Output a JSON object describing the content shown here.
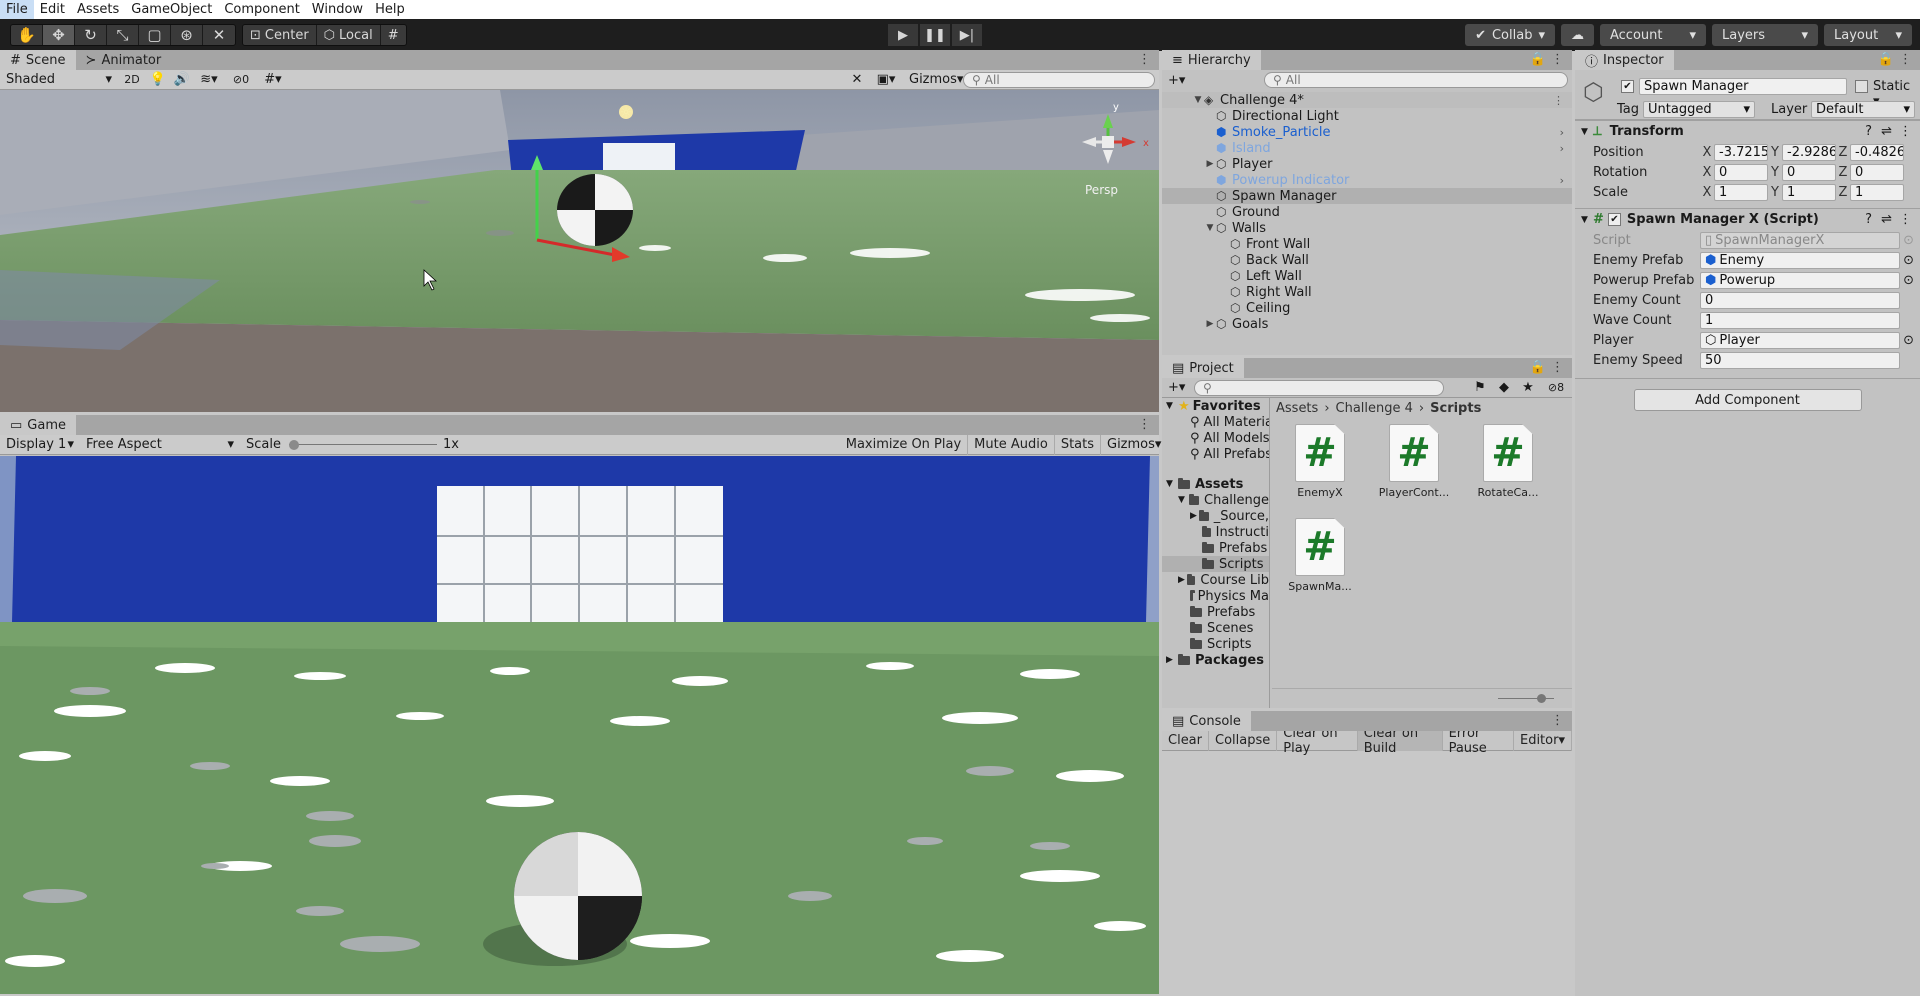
{
  "menu": [
    "File",
    "Edit",
    "Assets",
    "GameObject",
    "Component",
    "Window",
    "Help"
  ],
  "toolbar": {
    "pivot_label": "Center",
    "space_label": "Local",
    "collab_label": "Collab",
    "account_label": "Account",
    "layers_label": "Layers",
    "layout_label": "Layout"
  },
  "scene_panel": {
    "tabs": [
      "Scene",
      "Animator"
    ],
    "shading": "Shaded",
    "mode_2d": "2D",
    "hidden_count": "0",
    "gizmos_label": "Gizmos",
    "search_placeholder": "All",
    "persp_label": "Persp",
    "gizmo_y": "y",
    "gizmo_x": "x"
  },
  "game_panel": {
    "tab": "Game",
    "display": "Display 1",
    "aspect": "Free Aspect",
    "scale_label": "Scale",
    "scale_value": "1x",
    "maximize": "Maximize On Play",
    "mute": "Mute Audio",
    "stats": "Stats",
    "gizmos_label": "Gizmos"
  },
  "hierarchy": {
    "title": "Hierarchy",
    "search_placeholder": "All",
    "scene_name": "Challenge 4*",
    "items": [
      {
        "label": "Directional Light",
        "kind": "normal"
      },
      {
        "label": "Smoke_Particle",
        "kind": "prefab"
      },
      {
        "label": "Island",
        "kind": "prefab-dim"
      },
      {
        "label": "Player",
        "kind": "normal"
      },
      {
        "label": "Powerup Indicator",
        "kind": "prefab-dim"
      },
      {
        "label": "Spawn Manager",
        "kind": "normal"
      },
      {
        "label": "Ground",
        "kind": "normal"
      },
      {
        "label": "Walls",
        "kind": "normal"
      },
      {
        "label": "Front Wall",
        "kind": "child"
      },
      {
        "label": "Back Wall",
        "kind": "child"
      },
      {
        "label": "Left Wall",
        "kind": "child"
      },
      {
        "label": "Right Wall",
        "kind": "child"
      },
      {
        "label": "Ceiling",
        "kind": "child"
      },
      {
        "label": "Goals",
        "kind": "normal"
      }
    ]
  },
  "project": {
    "title": "Project",
    "hidden_count": "8",
    "favorites_label": "Favorites",
    "favorites": [
      "All Materia",
      "All Models",
      "All Prefabs"
    ],
    "assets_label": "Assets",
    "tree": [
      "Challenge",
      "_Source,",
      "Instructi",
      "Prefabs",
      "Scripts",
      "Course Lib",
      "Physics Ma",
      "Prefabs",
      "Scenes",
      "Scripts"
    ],
    "packages_label": "Packages",
    "breadcrumb": [
      "Assets",
      "Challenge 4",
      "Scripts"
    ],
    "files": [
      "EnemyX",
      "PlayerCont...",
      "RotateCa...",
      "SpawnMa..."
    ]
  },
  "console": {
    "title": "Console",
    "buttons": [
      "Clear",
      "Collapse",
      "Clear on Play",
      "Clear on Build",
      "Error Pause",
      "Editor"
    ]
  },
  "inspector": {
    "title": "Inspector",
    "object_name": "Spawn Manager",
    "static_label": "Static",
    "tag_label": "Tag",
    "tag_value": "Untagged",
    "layer_label": "Layer",
    "layer_value": "Default",
    "transform": {
      "title": "Transform",
      "position_label": "Position",
      "rotation_label": "Rotation",
      "scale_label": "Scale",
      "position": [
        "-3.7215",
        "-2.9286",
        "-0.4826"
      ],
      "rotation": [
        "0",
        "0",
        "0"
      ],
      "scale": [
        "1",
        "1",
        "1"
      ]
    },
    "script_component": {
      "title": "Spawn Manager X (Script)",
      "script_label": "Script",
      "script_value": "SpawnManagerX",
      "enemy_prefab_label": "Enemy Prefab",
      "enemy_prefab_value": "Enemy",
      "powerup_prefab_label": "Powerup Prefab",
      "powerup_prefab_value": "Powerup",
      "enemy_count_label": "Enemy Count",
      "enemy_count_value": "0",
      "wave_count_label": "Wave Count",
      "wave_count_value": "1",
      "player_label": "Player",
      "player_value": "Player",
      "enemy_speed_label": "Enemy Speed",
      "enemy_speed_value": "50"
    },
    "add_component": "Add Component"
  },
  "colors": {
    "wall_blue": "#1e39a8",
    "grass": "#6f9a63",
    "prefab_blue": "#1a5fcf"
  }
}
